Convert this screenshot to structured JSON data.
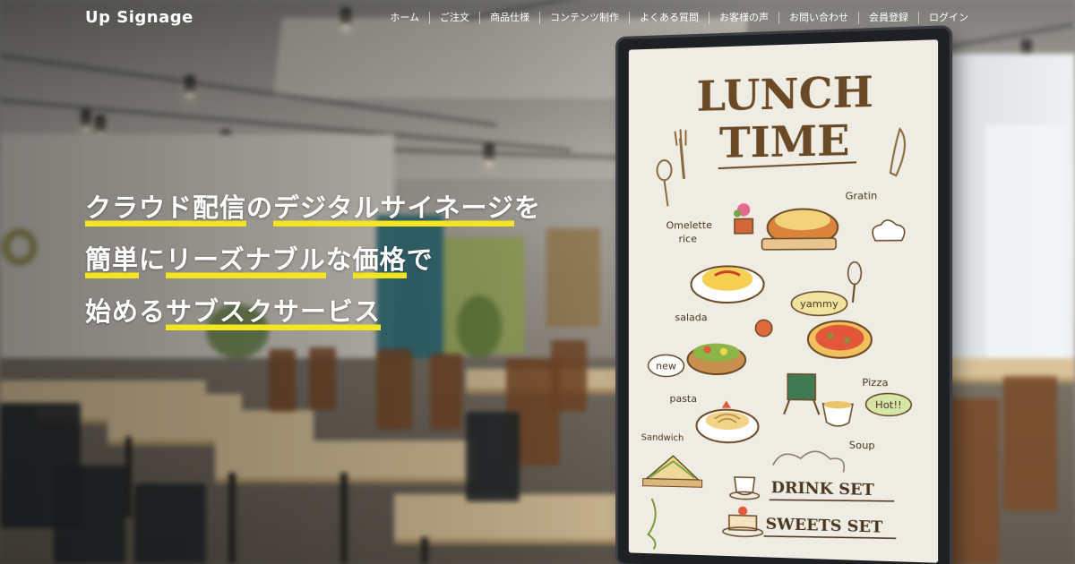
{
  "site": {
    "logo": "Up Signage"
  },
  "nav": {
    "items": [
      {
        "label": "ホーム"
      },
      {
        "label": "ご注文"
      },
      {
        "label": "商品仕様"
      },
      {
        "label": "コンテンツ制作"
      },
      {
        "label": "よくある質問"
      },
      {
        "label": "お客様の声"
      },
      {
        "label": "お問い合わせ"
      },
      {
        "label": "会員登録"
      },
      {
        "label": "ログイン"
      }
    ]
  },
  "hero": {
    "line1": {
      "a": "クラウド配信",
      "b": "の",
      "c": "デジタルサイネージ",
      "d": "を"
    },
    "line2": {
      "a": "簡単",
      "b": "に",
      "c": "リーズナブル",
      "d": "な",
      "e": "価格",
      "f": "で"
    },
    "line3": {
      "a": "始める",
      "b": "サブスクサービス"
    },
    "highlight_color": "#f3e51f"
  },
  "signage": {
    "title_line1": "LUNCH",
    "title_line2": "TIME",
    "labels": {
      "omelette": "Omelette",
      "rice": "rice",
      "gratin": "Gratin",
      "yammy": "yammy",
      "salada": "salada",
      "pizza": "Pizza",
      "new": "new",
      "pasta": "pasta",
      "hot": "Hot!!",
      "soup": "Soup",
      "sandwich": "Sandwich"
    },
    "drink_set": "DRINK SET",
    "sweets_set": "SWEETS SET"
  }
}
